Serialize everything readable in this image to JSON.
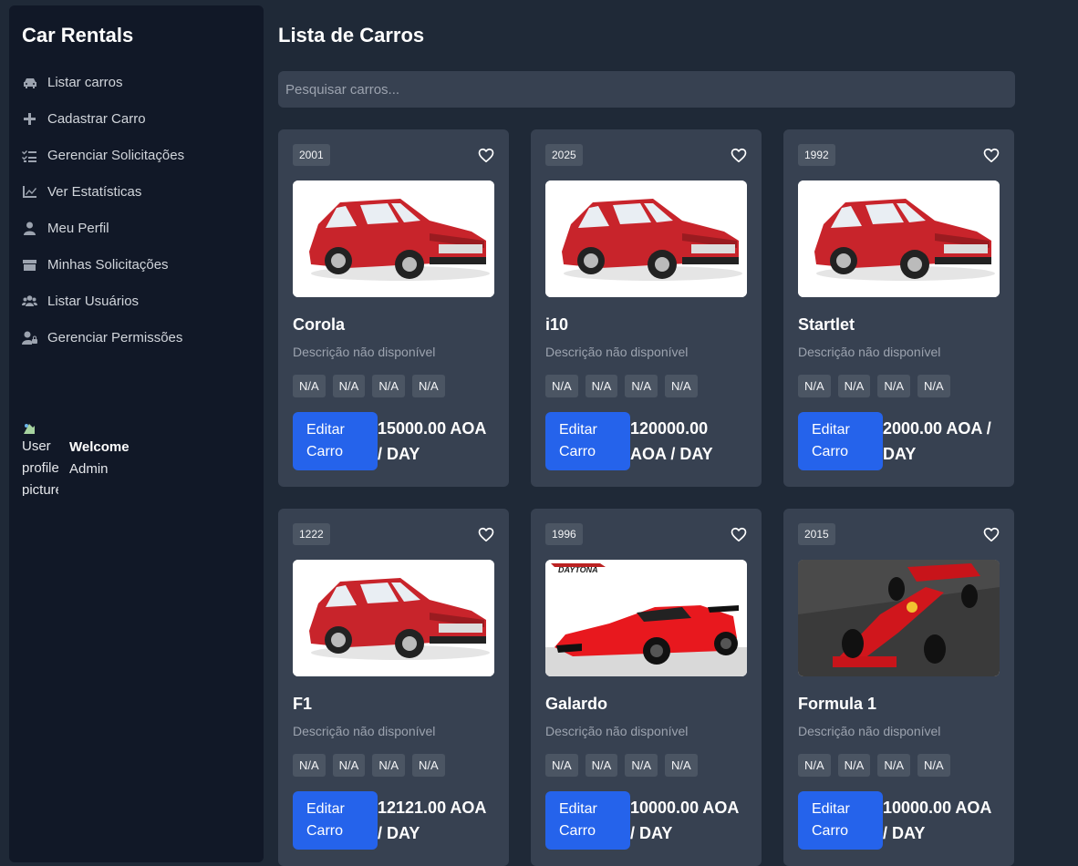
{
  "sidebar": {
    "brand": "Car Rentals",
    "items": [
      {
        "label": "Listar carros",
        "icon": "car-icon"
      },
      {
        "label": "Cadastrar Carro",
        "icon": "plus-icon"
      },
      {
        "label": "Gerenciar Solicitações",
        "icon": "list-check-icon"
      },
      {
        "label": "Ver Estatísticas",
        "icon": "chart-line-icon"
      },
      {
        "label": "Meu Perfil",
        "icon": "user-icon"
      },
      {
        "label": "Minhas Solicitações",
        "icon": "box-icon"
      },
      {
        "label": "Listar Usuários",
        "icon": "users-icon"
      },
      {
        "label": "Gerenciar Permissões",
        "icon": "user-lock-icon"
      }
    ],
    "user": {
      "avatar_alt": "User profile picture",
      "welcome": "Welcome",
      "name": "Admin"
    }
  },
  "main": {
    "title": "Lista de Carros",
    "search_placeholder": "Pesquisar carros...",
    "cars": [
      {
        "year": "2001",
        "name": "Corola",
        "description": "Descrição não disponível",
        "specs": [
          "N/A",
          "N/A",
          "N/A",
          "N/A"
        ],
        "edit_label": "Editar Carro",
        "price": "15000.00 AOA / DAY",
        "image": "red-hatchback"
      },
      {
        "year": "2025",
        "name": "i10",
        "description": "Descrição não disponível",
        "specs": [
          "N/A",
          "N/A",
          "N/A",
          "N/A"
        ],
        "edit_label": "Editar Carro",
        "price": "120000.00 AOA / DAY",
        "image": "red-hatchback"
      },
      {
        "year": "1992",
        "name": "Startlet",
        "description": "Descrição não disponível",
        "specs": [
          "N/A",
          "N/A",
          "N/A",
          "N/A"
        ],
        "edit_label": "Editar Carro",
        "price": "2000.00 AOA / DAY",
        "image": "red-hatchback"
      },
      {
        "year": "1222",
        "name": "F1",
        "description": "Descrição não disponível",
        "specs": [
          "N/A",
          "N/A",
          "N/A",
          "N/A"
        ],
        "edit_label": "Editar Carro",
        "price": "12121.00 AOA / DAY",
        "image": "red-hatchback"
      },
      {
        "year": "1996",
        "name": "Galardo",
        "description": "Descrição não disponível",
        "specs": [
          "N/A",
          "N/A",
          "N/A",
          "N/A"
        ],
        "edit_label": "Editar Carro",
        "price": "10000.00 AOA / DAY",
        "image": "red-supercar",
        "image_text": "DAYTONA"
      },
      {
        "year": "2015",
        "name": "Formula 1",
        "description": "Descrição não disponível",
        "specs": [
          "N/A",
          "N/A",
          "N/A",
          "N/A"
        ],
        "edit_label": "Editar Carro",
        "price": "10000.00 AOA / DAY",
        "image": "red-f1-car"
      }
    ]
  },
  "colors": {
    "page_bg": "#1f2937",
    "sidebar_bg": "#111827",
    "card_bg": "#374151",
    "chip_bg": "#4b5563",
    "accent": "#2563eb"
  }
}
